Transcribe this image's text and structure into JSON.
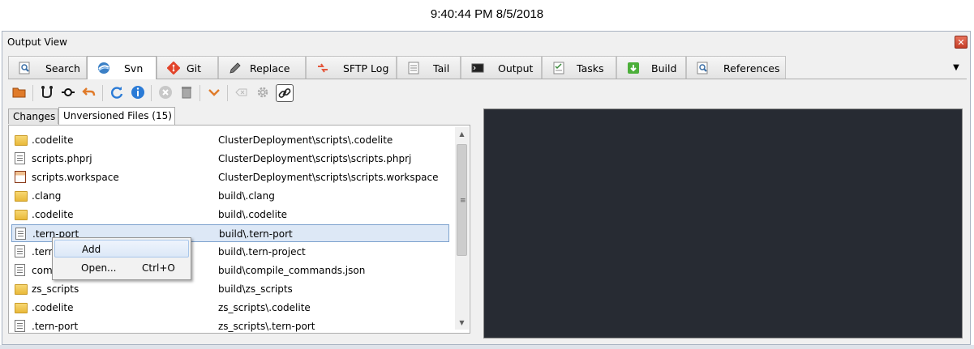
{
  "clock": "9:40:44 PM 8/5/2018",
  "panel": {
    "title": "Output View"
  },
  "tabs": [
    {
      "label": "Search",
      "icon": "search-icon"
    },
    {
      "label": "Svn",
      "icon": "svn-icon"
    },
    {
      "label": "Git",
      "icon": "git-icon"
    },
    {
      "label": "Replace",
      "icon": "pencil-icon"
    },
    {
      "label": "SFTP Log",
      "icon": "sftp-icon"
    },
    {
      "label": "Tail",
      "icon": "tail-icon"
    },
    {
      "label": "Output",
      "icon": "terminal-icon"
    },
    {
      "label": "Tasks",
      "icon": "tasks-icon"
    },
    {
      "label": "Build",
      "icon": "build-icon"
    },
    {
      "label": "References",
      "icon": "references-icon"
    }
  ],
  "active_tab": "Svn",
  "subtabs": [
    {
      "label": "Changes"
    },
    {
      "label": "Unversioned Files (15)"
    }
  ],
  "files": [
    {
      "name": ".codelite",
      "path": "ClusterDeployment\\scripts\\.codelite",
      "type": "folder"
    },
    {
      "name": "scripts.phprj",
      "path": "ClusterDeployment\\scripts\\scripts.phprj",
      "type": "file"
    },
    {
      "name": "scripts.workspace",
      "path": "ClusterDeployment\\scripts\\scripts.workspace",
      "type": "workspace"
    },
    {
      "name": ".clang",
      "path": "build\\.clang",
      "type": "folder"
    },
    {
      "name": ".codelite",
      "path": "build\\.codelite",
      "type": "folder"
    },
    {
      "name": ".tern-port",
      "path": "build\\.tern-port",
      "type": "file"
    },
    {
      "name": ".tern",
      "path": "build\\.tern-project",
      "type": "file"
    },
    {
      "name": "com",
      "path": "build\\compile_commands.json",
      "type": "file"
    },
    {
      "name": "zs_scripts",
      "path": "build\\zs_scripts",
      "type": "folder"
    },
    {
      "name": ".codelite",
      "path": "zs_scripts\\.codelite",
      "type": "folder"
    },
    {
      "name": ".tern-port",
      "path": "zs_scripts\\.tern-port",
      "type": "file"
    }
  ],
  "context_menu": {
    "items": [
      {
        "label": "Add",
        "shortcut": ""
      },
      {
        "label": "Open...",
        "shortcut": "Ctrl+O"
      }
    ]
  },
  "colors": {
    "terminal_bg": "#272b33",
    "selection": "#dde8f6",
    "accent": "#7da2ce"
  }
}
